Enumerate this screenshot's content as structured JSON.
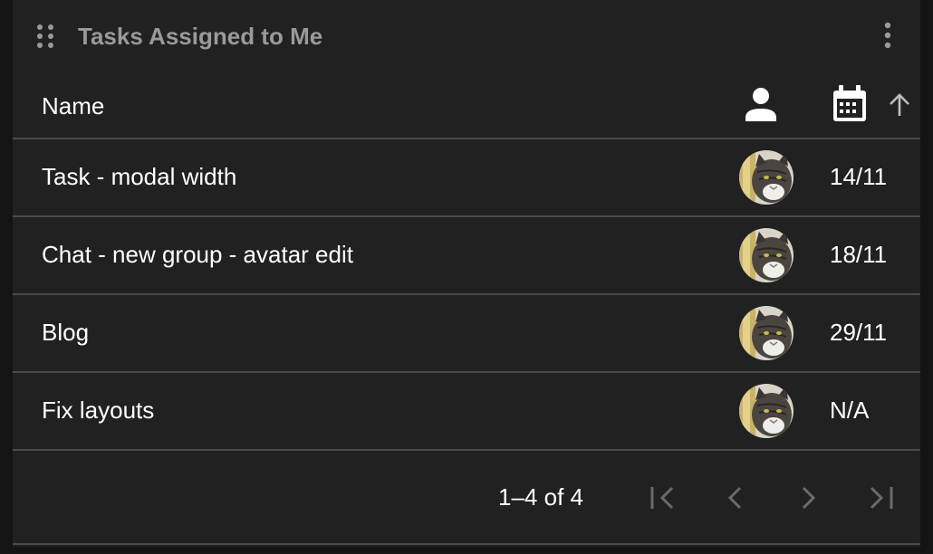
{
  "widget": {
    "title": "Tasks Assigned to Me",
    "drag_icon": "drag-handle-icon",
    "menu_icon": "more-vert-icon"
  },
  "table": {
    "columns": {
      "name": "Name",
      "assignee_icon": "person-icon",
      "due_icon": "calendar-icon",
      "sort_icon": "arrow-up-icon"
    },
    "rows": [
      {
        "name": "Task - modal width",
        "due": "14/11"
      },
      {
        "name": "Chat - new group - avatar edit",
        "due": "18/11"
      },
      {
        "name": "Blog",
        "due": "29/11"
      },
      {
        "name": "Fix layouts",
        "due": "N/A"
      }
    ]
  },
  "pagination": {
    "range": "1–4 of 4",
    "icons": [
      "first-page-icon",
      "prev-page-icon",
      "next-page-icon",
      "last-page-icon"
    ]
  },
  "colors": {
    "background": "#212121",
    "title": "#9a9a9a",
    "text": "#ffffff",
    "divider": "#4a4a4a",
    "disabled_icon": "#6a6a6a"
  }
}
